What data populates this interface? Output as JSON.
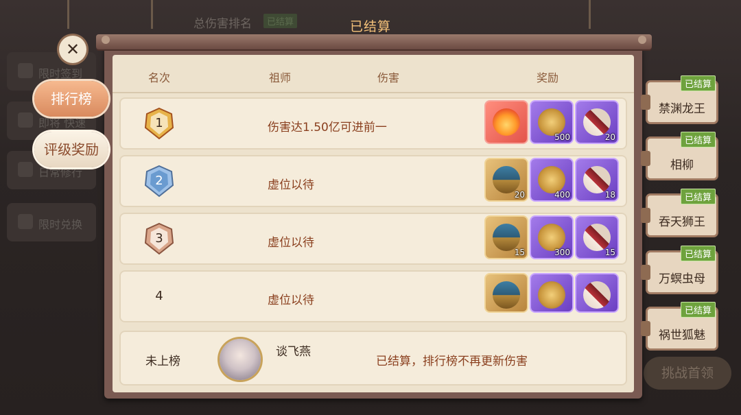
{
  "background": {
    "title": "总伤害排名",
    "title_badge": "已结算",
    "left_items": [
      "限时签到",
      "即将 快速出战",
      "日常修行",
      "限时兑换"
    ],
    "challenge_button": "挑战首领"
  },
  "panel": {
    "title": "已结算",
    "headers": {
      "rank": "名次",
      "master": "祖师",
      "damage": "伤害",
      "reward": "奖励"
    },
    "rows": [
      {
        "rank": "1",
        "desc": "伤害达1.50亿可进前一",
        "rewards": [
          {
            "type": "flame",
            "qty": ""
          },
          {
            "type": "token",
            "qty": "500"
          },
          {
            "type": "scroll",
            "qty": "20"
          }
        ]
      },
      {
        "rank": "2",
        "desc": "虚位以待",
        "rewards": [
          {
            "type": "chest",
            "qty": "20"
          },
          {
            "type": "token",
            "qty": "400"
          },
          {
            "type": "scroll",
            "qty": "18"
          }
        ]
      },
      {
        "rank": "3",
        "desc": "虚位以待",
        "rewards": [
          {
            "type": "chest",
            "qty": "15"
          },
          {
            "type": "token",
            "qty": "300"
          },
          {
            "type": "scroll",
            "qty": "15"
          }
        ]
      },
      {
        "rank": "4",
        "desc": "虚位以待",
        "rewards": [
          {
            "type": "chest",
            "qty": ""
          },
          {
            "type": "token",
            "qty": ""
          },
          {
            "type": "scroll",
            "qty": ""
          }
        ]
      }
    ],
    "footer": {
      "rank": "未上榜",
      "name": "谈飞燕",
      "note": "已结算，排行榜不再更新伤害"
    }
  },
  "left_buttons": {
    "ranking": "排行榜",
    "rating_rewards": "评级奖励",
    "close": "✕"
  },
  "boss_tabs": [
    {
      "name": "禁渊龙王",
      "badge": "已结算"
    },
    {
      "name": "相柳",
      "badge": "已结算"
    },
    {
      "name": "吞天狮王",
      "badge": "已结算"
    },
    {
      "name": "万螟虫母",
      "badge": "已结算"
    },
    {
      "name": "祸世狐魅",
      "badge": "已结算"
    }
  ]
}
